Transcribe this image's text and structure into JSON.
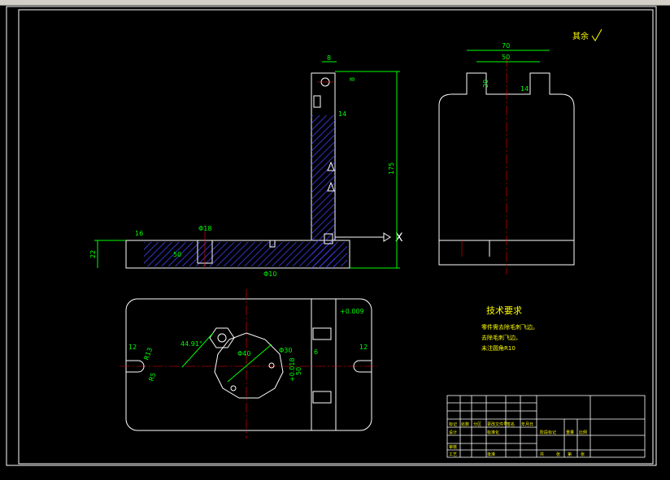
{
  "window": {
    "topbar_color": "#d4d0c8"
  },
  "colors": {
    "outline": "#ffffff",
    "dimension": "#00ff00",
    "center_line": "#ff0000",
    "hatch": "#4444ff",
    "text": "#ffff00"
  },
  "surface_finish_note": "其余",
  "dimensions": {
    "width_70": "70",
    "width_50": "50",
    "height_20": "20",
    "height_175": "175",
    "height_22": "22",
    "dim_8_top": "8",
    "dim_8_side": "8",
    "dim_16": "16",
    "dim_18": "Φ18",
    "dim_50_small": "50",
    "dim_10": "Φ10",
    "dim_14": "14",
    "angle": "44.91°",
    "dim_40": "Φ40",
    "dim_30": "Φ30",
    "dim_50_vert": "50",
    "dim_6": "6",
    "dim_r12_left": "12",
    "dim_r12_right": "12",
    "dim_r13": "R13",
    "dim_r5": "R5",
    "tol_009": "+0.009",
    "tol_018": "+0.018",
    "x_marker": "X"
  },
  "technical_requirements": {
    "title": "技术要求",
    "lines": [
      "零件需去除毛刺飞边。",
      "去除毛刺飞边。",
      "未注圆角R10"
    ]
  },
  "title_block": {
    "cells_row1": [
      "标记",
      "处数",
      "分区",
      "更改文件号",
      "签名",
      "年月日"
    ],
    "cells_row2": [
      "设计",
      "",
      "标准化",
      "",
      "阶段标记",
      "重量",
      "比例"
    ],
    "cells_row3": [
      "审核",
      "",
      "",
      "",
      "",
      "",
      ""
    ],
    "cells_row4": [
      "工艺",
      "",
      "批准",
      "",
      "共",
      "张",
      "第",
      "张"
    ]
  }
}
